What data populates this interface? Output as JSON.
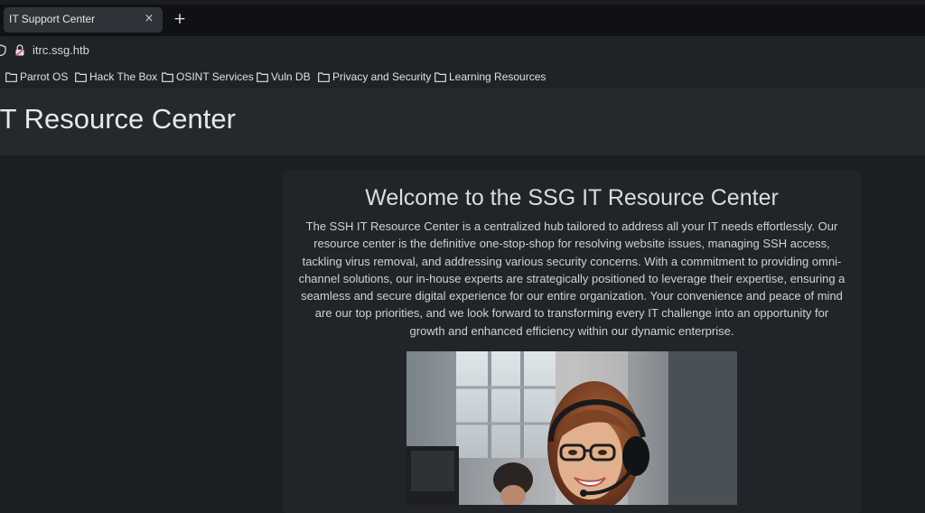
{
  "browser": {
    "tab_title": "IT Support Center",
    "tab_close": "×",
    "new_tab": "+",
    "url": "itrc.ssg.htb",
    "bookmarks": [
      {
        "label": "Parrot OS"
      },
      {
        "label": "Hack The Box"
      },
      {
        "label": "OSINT Services"
      },
      {
        "label": "Vuln DB"
      },
      {
        "label": "Privacy and Security"
      },
      {
        "label": "Learning Resources"
      }
    ]
  },
  "page": {
    "site_title": "IT Resource Center",
    "welcome_heading": "Welcome to the SSG IT Resource Center",
    "intro_text": "The SSH IT Resource Center is a centralized hub tailored to address all your IT needs effortlessly. Our resource center is the definitive one-stop-shop for resolving website issues, managing SSH access, tackling virus removal, and addressing various security concerns. With a commitment to providing omni-channel solutions, our in-house experts are strategically positioned to leverage their expertise, ensuring a seamless and secure digital experience for our entire organization. Your convenience and peace of mind are our top priorities, and we look forward to transforming every IT challenge into an opportunity for growth and enhanced efficiency within our dynamic enterprise."
  },
  "icons": {
    "tab_close": "close-icon",
    "new_tab": "plus-icon",
    "security": "shield-icon",
    "lock": "lock-icon",
    "bookmark": "folder-icon"
  },
  "colors": {
    "page_background": "#1b1e22",
    "header_background": "#25292d",
    "card_background": "#212428",
    "chrome_background": "#1f2226",
    "lock_accent": "#e0476b"
  }
}
